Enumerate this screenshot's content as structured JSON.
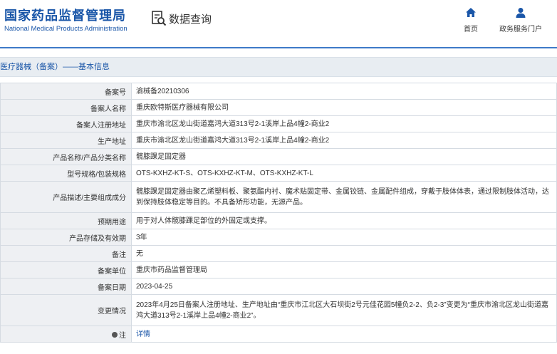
{
  "header": {
    "brand_cn": "国家药品监督管理局",
    "brand_en": "National Medical Products Administration",
    "data_query": "数据查询",
    "nav_home": "首页",
    "nav_portal": "政务服务门户"
  },
  "breadcrumb": "医疗器械（备案）——基本信息",
  "rows": [
    {
      "label": "备案号",
      "value": "渝械备20210306"
    },
    {
      "label": "备案人名称",
      "value": "重庆欧特斯医疗器械有限公司"
    },
    {
      "label": "备案人注册地址",
      "value": "重庆市渝北区龙山街道嘉鸿大道313号2-1溪岸上品4幢2-商业2"
    },
    {
      "label": "生产地址",
      "value": "重庆市渝北区龙山街道嘉鸿大道313号2-1溪岸上品4幢2-商业2"
    },
    {
      "label": "产品名称/产品分类名称",
      "value": "髋膝踝足固定器"
    },
    {
      "label": "型号规格/包装规格",
      "value": "OTS-KXHZ-KT-S、OTS-KXHZ-KT-M、OTS-KXHZ-KT-L"
    },
    {
      "label": "产品描述/主要组成成分",
      "value": "髋膝踝足固定器由聚乙烯塑料板、聚氨酯内衬、魔术贴固定带、金属铰链、金属配件组成，穿戴于肢体体表，通过限制肢体活动，达到保持肢体稳定等目的。不具备矫形功能，无源产品。"
    },
    {
      "label": "预期用途",
      "value": "用于对人体髋膝踝足部位的外固定或支撑。"
    },
    {
      "label": "产品存储及有效期",
      "value": "3年"
    },
    {
      "label": "备注",
      "value": "无"
    },
    {
      "label": "备案单位",
      "value": "重庆市药品监督管理局"
    },
    {
      "label": "备案日期",
      "value": "2023-04-25"
    },
    {
      "label": "变更情况",
      "value": "2023年4月25日备案人注册地址、生产地址由“重庆市江北区大石坝街2号元佳花园5幢负2-2、负2-3”变更为“重庆市渝北区龙山街道嘉鸿大道313号2-1溪岸上品4幢2-商业2”。"
    }
  ],
  "note_row": {
    "label": "注",
    "link": "详情"
  }
}
